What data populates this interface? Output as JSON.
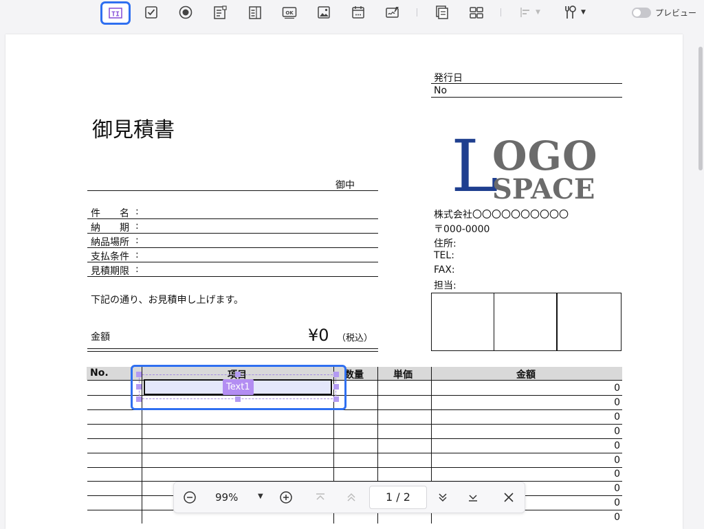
{
  "toolbar": {
    "tools": [
      {
        "name": "text-field",
        "icon": "text-field-icon",
        "active": true
      },
      {
        "name": "checkbox",
        "icon": "checkbox-icon"
      },
      {
        "name": "radio-button",
        "icon": "radio-button-icon"
      },
      {
        "name": "combo-box",
        "icon": "combo-box-icon"
      },
      {
        "name": "list-box",
        "icon": "list-box-icon"
      },
      {
        "name": "button",
        "icon": "ok-button-icon",
        "label": "OK"
      },
      {
        "name": "image",
        "icon": "image-icon"
      },
      {
        "name": "date",
        "icon": "calendar-icon"
      },
      {
        "name": "signature",
        "icon": "signature-icon"
      },
      {
        "name": "multi-page",
        "icon": "pages-icon"
      },
      {
        "name": "grid",
        "icon": "grid-icon"
      },
      {
        "name": "align",
        "icon": "align-icon"
      },
      {
        "name": "tools",
        "icon": "tools-icon"
      }
    ],
    "preview_label": "プレビュー",
    "accent_color": "#2f6ff0"
  },
  "document": {
    "title": "御見積書",
    "issue_date_label": "発行日",
    "no_label": "No",
    "recipient_suffix": "御中",
    "fields": [
      {
        "label": "件　　名"
      },
      {
        "label": "納　　期"
      },
      {
        "label": "納品場所"
      },
      {
        "label": "支払条件"
      },
      {
        "label": "見積期限"
      }
    ],
    "field_colon": ":",
    "intro_text": "下記の通り、お見積申し上げます。",
    "amount_label": "金額",
    "amount_value": "¥0",
    "tax_note": "（税込）",
    "logo": {
      "letter": "L",
      "line1": "OGO",
      "line2": "SPACE"
    },
    "company": {
      "name": "株式会社〇〇〇〇〇〇〇〇〇〇",
      "postal": "〒000-0000",
      "address_label": "住所:",
      "tel_label": "TEL:",
      "fax_label": "FAX:",
      "contact_label": "担当:"
    },
    "table": {
      "headers": [
        "No.",
        "項目",
        "数量",
        "単価",
        "金額"
      ],
      "amounts": [
        "0",
        "0",
        "0",
        "0",
        "0",
        "0",
        "0",
        "0",
        "0",
        "0"
      ]
    }
  },
  "form_field": {
    "name": "Text1"
  },
  "zoom": {
    "value": "99%",
    "current_page": "1",
    "total_pages": "2",
    "page_separator": "/"
  }
}
